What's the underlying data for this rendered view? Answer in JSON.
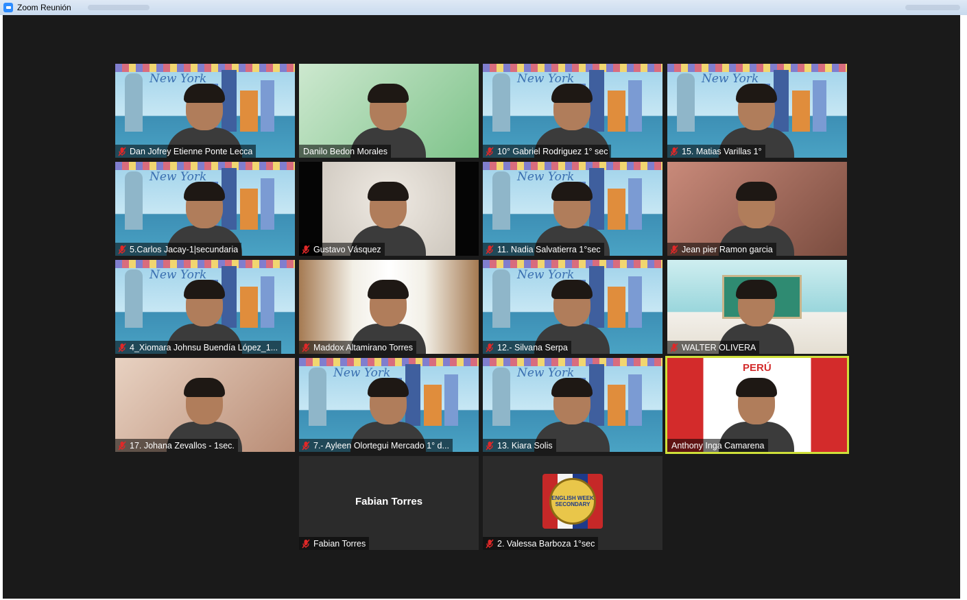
{
  "window": {
    "title": "Zoom Reunión"
  },
  "participants": [
    {
      "name": "Dan Jofrey Etienne Ponte Lecca",
      "muted": true,
      "bg": "ny"
    },
    {
      "name": "Danilo Bedon Morales",
      "muted": false,
      "bg": "green"
    },
    {
      "name": "10° Gabriel Rodriguez 1° sec",
      "muted": true,
      "bg": "ny"
    },
    {
      "name": "15. Matias Varillas 1°",
      "muted": true,
      "bg": "ny"
    },
    {
      "name": "5.Carlos Jacay-1|secundaria",
      "muted": true,
      "bg": "ny"
    },
    {
      "name": "Gustavo Vásquez",
      "muted": true,
      "bg": "wall"
    },
    {
      "name": "11. Nadia Salvatierra  1°sec",
      "muted": true,
      "bg": "ny"
    },
    {
      "name": "Jean pier Ramon garcia",
      "muted": true,
      "bg": "warm"
    },
    {
      "name": "4_Xiomara Johnsu Buendía López_1...",
      "muted": true,
      "bg": "ny"
    },
    {
      "name": "Maddox Altamirano Torres",
      "muted": true,
      "bg": "hall"
    },
    {
      "name": "12.- Silvana Serpa",
      "muted": true,
      "bg": "ny"
    },
    {
      "name": "WALTER OLIVERA",
      "muted": true,
      "bg": "class"
    },
    {
      "name": "17. Johana Zevallos - 1sec.",
      "muted": true,
      "bg": "beige"
    },
    {
      "name": "7.- Ayleen Olortegui Mercado 1° d...",
      "muted": true,
      "bg": "ny"
    },
    {
      "name": "13. Kiara Solis",
      "muted": true,
      "bg": "ny"
    },
    {
      "name": "Anthony Inga Camarena",
      "muted": false,
      "bg": "peru",
      "active": true
    },
    {
      "name": "Fabian Torres",
      "muted": true,
      "bg": "none",
      "center_name": "Fabian Torres"
    },
    {
      "name": "2. Valessa Barboza 1°sec",
      "muted": true,
      "bg": "badge"
    }
  ],
  "background_text": {
    "new_york": "New York",
    "peru": "PERÚ"
  },
  "badge_text": "ENGLISH WEEK SECONDARY",
  "colors": {
    "meeting_bg": "#1a1a1a",
    "active_speaker": "#cfe03a",
    "mute_icon": "#e02828"
  }
}
